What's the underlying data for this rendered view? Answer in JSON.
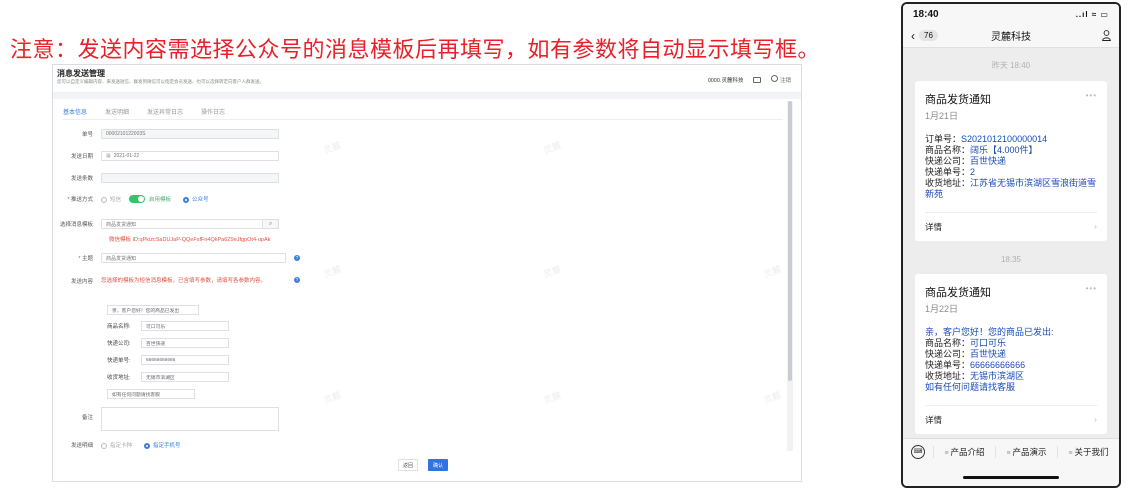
{
  "headline": "注意：发送内容需选择公众号的消息模板后再填写，如有参数将自动显示填写框。",
  "admin": {
    "title": "消息发送管理",
    "subtitle": "您可以自定义编辑内容、来发送短信、群发到微信可以指定会员发送、也可以选择转定向客户人群发送。",
    "company": "0000.灵麓科技",
    "logout": "注销",
    "tabs": [
      "基本信息",
      "发送明细",
      "发送异常日志",
      "操作日志"
    ],
    "fields": {
      "order_label": "单号",
      "order_value": "0000210122003S",
      "date_label": "发送日期",
      "date_value": "2021-01-22",
      "count_label": "发送条数",
      "method_label": "推送方式",
      "method_sms": "短信",
      "method_toggle_text": "启用模板",
      "method_wechat": "公众号",
      "template_label": "选择消息模板",
      "template_value": "商品发货通知",
      "template_id": "微信模板 ID:qPkizcSaDUJaP-QQeFsfFn4QkPa6Z9eJfgpOt4-upAk",
      "subject_label": "主题",
      "subject_value": "商品发货通知",
      "content_label": "发送内容",
      "content_hint": "您选择的模板为短信消息模板，已含填写参数，请填写各参数内容。",
      "param_first": "亲，客户您好！您的商品已发出",
      "params": [
        {
          "label": "商品名称:",
          "value": "可口可乐"
        },
        {
          "label": "快递公司:",
          "value": "百世快递"
        },
        {
          "label": "快递单号:",
          "value": "66666666666"
        },
        {
          "label": "收货地址:",
          "value": "无锡市滨湖区"
        }
      ],
      "param_remark": "如有任何问题请找客服",
      "note_label": "备注",
      "target_label": "发送明细",
      "target_card": "指定卡种",
      "target_phone": "指定手机号"
    },
    "buttons": {
      "back": "返回",
      "ok": "确认"
    },
    "watermark": "灵麓"
  },
  "phone": {
    "time": "18:40",
    "status_icons": "..ıl ≈ ▭",
    "back_badge": "76",
    "title": "灵麓科技",
    "sep1": "昨天 18:40",
    "card1": {
      "title": "商品发货通知",
      "date": "1月21日",
      "lines": [
        {
          "k": "订单号：",
          "v": "S2021012100000014"
        },
        {
          "k": "商品名称：",
          "v": "阔乐【4.000件】"
        },
        {
          "k": "快递公司：",
          "v": "百世快递"
        },
        {
          "k": "快递单号：",
          "v": "2"
        },
        {
          "k": "收货地址：",
          "v": "江苏省无锡市滨湖区雪浪街道雪新苑"
        }
      ],
      "detail": "详情"
    },
    "sep2": "18:35",
    "card2": {
      "title": "商品发货通知",
      "date": "1月22日",
      "lines": [
        {
          "k": "",
          "v": "亲，客户您好！您的商品已发出:"
        },
        {
          "k": "商品名称：",
          "v": "可口可乐"
        },
        {
          "k": "快递公司：",
          "v": "百世快递"
        },
        {
          "k": "快递单号：",
          "v": "66666666666"
        },
        {
          "k": "收货地址：",
          "v": "无锡市滨湖区"
        },
        {
          "k": "",
          "v": "如有任何问题请找客服"
        }
      ],
      "detail": "详情"
    },
    "menu": [
      "产品介绍",
      "产品演示",
      "关于我们"
    ]
  }
}
